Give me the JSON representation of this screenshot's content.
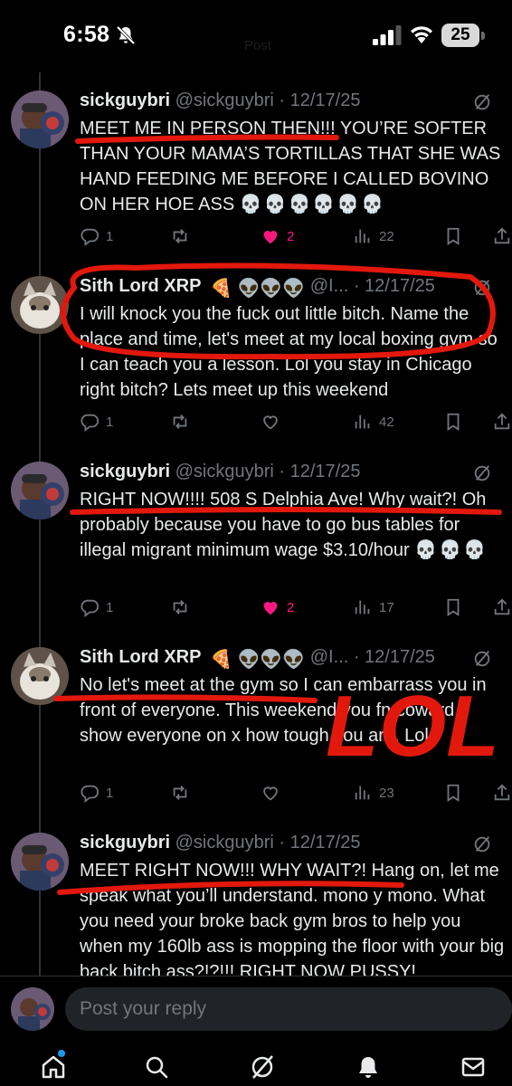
{
  "status_bar": {
    "time": "6:58",
    "battery": "25",
    "faint_label": "Post"
  },
  "colors": {
    "accent": "#1d9bf0",
    "like": "#f91880",
    "annotation": "#e3180c",
    "muted": "#71767b"
  },
  "tweets": [
    {
      "name": "sickguybri",
      "handle": "@sickguybri",
      "date": "· 12/17/25",
      "text": "MEET ME IN PERSON THEN!!! YOU’RE SOFTER THAN YOUR MAMA’S TORTILLAS THAT SHE WAS HAND FEEDING ME BEFORE I CALLED BOVINO ON HER HOE ASS",
      "skulls": "💀💀💀💀💀💀",
      "replies": "1",
      "likes": "2",
      "views": "22",
      "liked": true
    },
    {
      "name": "Sith Lord XRP",
      "emojis": "🍕 👽👽👽",
      "handle": "@I...",
      "date": "· 12/17/25",
      "text": "I will knock you the fuck out little bitch. Name the place and time, let's meet at my local boxing gym so I can teach you a lesson. Lol you stay in Chicago right bitch? Lets meet up this weekend",
      "replies": "1",
      "likes": "",
      "views": "42",
      "liked": false
    },
    {
      "name": "sickguybri",
      "handle": "@sickguybri",
      "date": "· 12/17/25",
      "text": "RIGHT NOW!!!! 508 S Delphia Ave! Why wait?! Oh probably because you have to go bus tables for illegal migrant minimum wage $3.10/hour",
      "skulls": "💀💀💀",
      "replies": "1",
      "likes": "2",
      "views": "17",
      "liked": true
    },
    {
      "name": "Sith Lord XRP",
      "emojis": "🍕 👽👽👽",
      "handle": "@I...",
      "date": "· 12/17/25",
      "text": "No let's meet at the gym so I can embarrass you in front of everyone. This weekend you fn coward, show everyone on x how tough you are. Lol",
      "replies": "1",
      "likes": "",
      "views": "23",
      "liked": false
    },
    {
      "name": "sickguybri",
      "handle": "@sickguybri",
      "date": "· 12/17/25",
      "text": "MEET RIGHT NOW!!! WHY WAIT?! Hang on, let me speak what you’ll understand. mono y mono. What you need your broke back gym bros to help you when my 160lb ass is mopping the floor with your big back bitch ass?!?!!! RIGHT NOW PUSSY!"
    }
  ],
  "annotation_text": "LOL",
  "reply_bar": {
    "placeholder": "Post your reply"
  },
  "nav": [
    "home-icon",
    "search-icon",
    "grok-icon",
    "notifications-icon",
    "messages-icon"
  ]
}
